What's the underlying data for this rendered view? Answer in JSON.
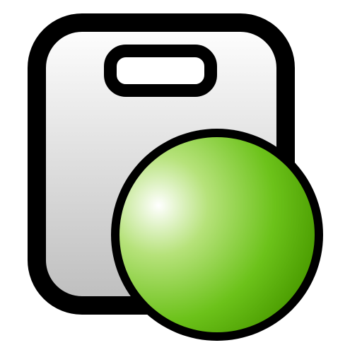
{
  "icon": {
    "name": "device-with-green-sphere",
    "parts": {
      "device": "scale-or-bag-icon",
      "handle": "handle-slot-icon",
      "badge": "green-sphere-icon"
    },
    "colors": {
      "outline": "#000000",
      "device_light": "#ffffff",
      "device_dark": "#bfbfbf",
      "sphere_highlight": "#ffffff",
      "sphere_mid": "#9ad84a",
      "sphere_dark": "#4a9a00"
    }
  }
}
